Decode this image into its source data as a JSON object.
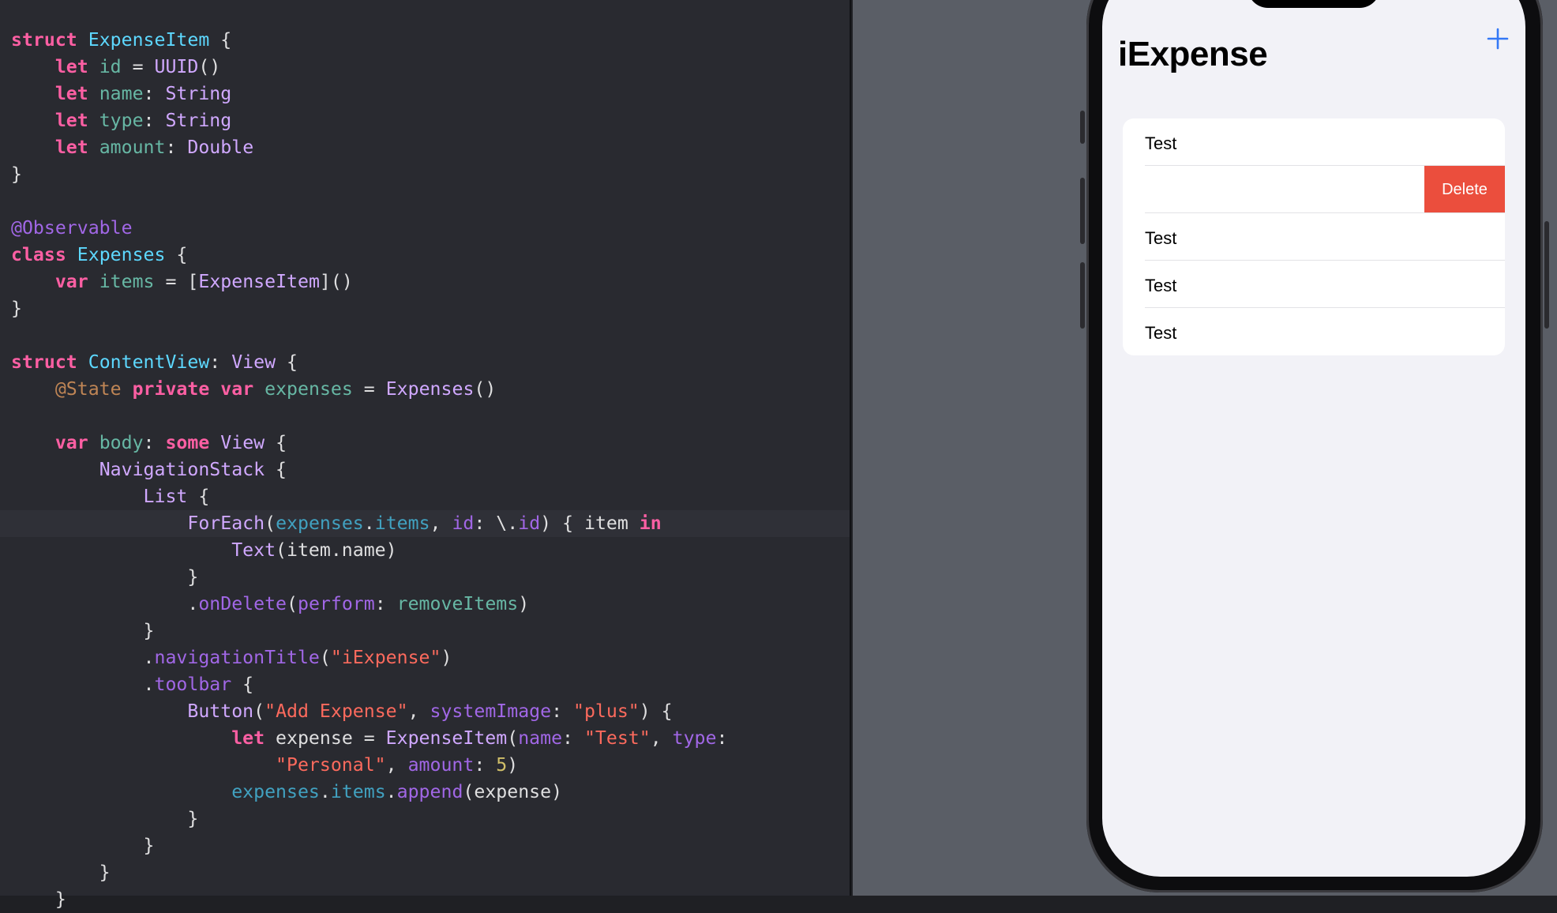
{
  "editor": {
    "lines": [
      [
        [
          "kw",
          "struct"
        ],
        [
          "plain",
          " "
        ],
        [
          "tydecl",
          "ExpenseItem"
        ],
        [
          "plain",
          " {"
        ]
      ],
      [
        [
          "plain",
          "    "
        ],
        [
          "kw",
          "let"
        ],
        [
          "plain",
          " "
        ],
        [
          "prop",
          "id"
        ],
        [
          "plain",
          " = "
        ],
        [
          "tyref",
          "UUID"
        ],
        [
          "plain",
          "()"
        ]
      ],
      [
        [
          "plain",
          "    "
        ],
        [
          "kw",
          "let"
        ],
        [
          "plain",
          " "
        ],
        [
          "prop",
          "name"
        ],
        [
          "plain",
          ": "
        ],
        [
          "tyref",
          "String"
        ]
      ],
      [
        [
          "plain",
          "    "
        ],
        [
          "kw",
          "let"
        ],
        [
          "plain",
          " "
        ],
        [
          "prop",
          "type"
        ],
        [
          "plain",
          ": "
        ],
        [
          "tyref",
          "String"
        ]
      ],
      [
        [
          "plain",
          "    "
        ],
        [
          "kw",
          "let"
        ],
        [
          "plain",
          " "
        ],
        [
          "prop",
          "amount"
        ],
        [
          "plain",
          ": "
        ],
        [
          "tyref",
          "Double"
        ]
      ],
      [
        [
          "plain",
          "}"
        ]
      ],
      [
        [
          "plain",
          ""
        ]
      ],
      [
        [
          "macro",
          "@Observable"
        ]
      ],
      [
        [
          "kw",
          "class"
        ],
        [
          "plain",
          " "
        ],
        [
          "tydecl",
          "Expenses"
        ],
        [
          "plain",
          " {"
        ]
      ],
      [
        [
          "plain",
          "    "
        ],
        [
          "kw",
          "var"
        ],
        [
          "plain",
          " "
        ],
        [
          "prop",
          "items"
        ],
        [
          "plain",
          " = ["
        ],
        [
          "tyref",
          "ExpenseItem"
        ],
        [
          "plain",
          "]()"
        ]
      ],
      [
        [
          "plain",
          "}"
        ]
      ],
      [
        [
          "plain",
          ""
        ]
      ],
      [
        [
          "kw",
          "struct"
        ],
        [
          "plain",
          " "
        ],
        [
          "tydecl",
          "ContentView"
        ],
        [
          "plain",
          ": "
        ],
        [
          "tyref",
          "View"
        ],
        [
          "plain",
          " {"
        ]
      ],
      [
        [
          "plain",
          "    "
        ],
        [
          "attr",
          "@State"
        ],
        [
          "plain",
          " "
        ],
        [
          "kw",
          "private"
        ],
        [
          "plain",
          " "
        ],
        [
          "kw",
          "var"
        ],
        [
          "plain",
          " "
        ],
        [
          "prop",
          "expenses"
        ],
        [
          "plain",
          " = "
        ],
        [
          "tyref",
          "Expenses"
        ],
        [
          "plain",
          "()"
        ]
      ],
      [
        [
          "plain",
          ""
        ]
      ],
      [
        [
          "plain",
          "    "
        ],
        [
          "kw",
          "var"
        ],
        [
          "plain",
          " "
        ],
        [
          "prop",
          "body"
        ],
        [
          "plain",
          ": "
        ],
        [
          "kw",
          "some"
        ],
        [
          "plain",
          " "
        ],
        [
          "tyref",
          "View"
        ],
        [
          "plain",
          " {"
        ]
      ],
      [
        [
          "plain",
          "        "
        ],
        [
          "tyref",
          "NavigationStack"
        ],
        [
          "plain",
          " {"
        ]
      ],
      [
        [
          "plain",
          "            "
        ],
        [
          "tyref",
          "List"
        ],
        [
          "plain",
          " {"
        ]
      ],
      [
        [
          "plain",
          "                "
        ],
        [
          "tyref",
          "ForEach"
        ],
        [
          "plain",
          "("
        ],
        [
          "propref",
          "expenses"
        ],
        [
          "plain",
          "."
        ],
        [
          "propref",
          "items"
        ],
        [
          "plain",
          ", "
        ],
        [
          "param",
          "id"
        ],
        [
          "plain",
          ": \\."
        ],
        [
          "param",
          "id"
        ],
        [
          "plain",
          ") { item "
        ],
        [
          "kw",
          "in"
        ]
      ],
      [
        [
          "plain",
          "                    "
        ],
        [
          "tyref",
          "Text"
        ],
        [
          "plain",
          "(item.name)"
        ]
      ],
      [
        [
          "plain",
          "                }"
        ]
      ],
      [
        [
          "plain",
          "                ."
        ],
        [
          "funcref",
          "onDelete"
        ],
        [
          "plain",
          "("
        ],
        [
          "param",
          "perform"
        ],
        [
          "plain",
          ": "
        ],
        [
          "func",
          "removeItems"
        ],
        [
          "plain",
          ")"
        ]
      ],
      [
        [
          "plain",
          "            }"
        ]
      ],
      [
        [
          "plain",
          "            ."
        ],
        [
          "funcref",
          "navigationTitle"
        ],
        [
          "plain",
          "("
        ],
        [
          "str",
          "\"iExpense\""
        ],
        [
          "plain",
          ")"
        ]
      ],
      [
        [
          "plain",
          "            ."
        ],
        [
          "funcref",
          "toolbar"
        ],
        [
          "plain",
          " {"
        ]
      ],
      [
        [
          "plain",
          "                "
        ],
        [
          "tyref",
          "Button"
        ],
        [
          "plain",
          "("
        ],
        [
          "str",
          "\"Add Expense\""
        ],
        [
          "plain",
          ", "
        ],
        [
          "param",
          "systemImage"
        ],
        [
          "plain",
          ": "
        ],
        [
          "str",
          "\"plus\""
        ],
        [
          "plain",
          ") {"
        ]
      ],
      [
        [
          "plain",
          "                    "
        ],
        [
          "kw",
          "let"
        ],
        [
          "plain",
          " expense = "
        ],
        [
          "tyref",
          "ExpenseItem"
        ],
        [
          "plain",
          "("
        ],
        [
          "param",
          "name"
        ],
        [
          "plain",
          ": "
        ],
        [
          "str",
          "\"Test\""
        ],
        [
          "plain",
          ", "
        ],
        [
          "param",
          "type"
        ],
        [
          "plain",
          ":"
        ]
      ],
      [
        [
          "plain",
          "                        "
        ],
        [
          "str",
          "\"Personal\""
        ],
        [
          "plain",
          ", "
        ],
        [
          "param",
          "amount"
        ],
        [
          "plain",
          ": "
        ],
        [
          "num",
          "5"
        ],
        [
          "plain",
          ")"
        ]
      ],
      [
        [
          "plain",
          "                    "
        ],
        [
          "propref",
          "expenses"
        ],
        [
          "plain",
          "."
        ],
        [
          "propref",
          "items"
        ],
        [
          "plain",
          "."
        ],
        [
          "funcref",
          "append"
        ],
        [
          "plain",
          "(expense)"
        ]
      ],
      [
        [
          "plain",
          "                }"
        ]
      ],
      [
        [
          "plain",
          "            }"
        ]
      ],
      [
        [
          "plain",
          "        }"
        ]
      ],
      [
        [
          "plain",
          "    }"
        ]
      ]
    ],
    "colors": {
      "keyword": "#fc5fa3",
      "type": "#d0a8ff",
      "type_declaration": "#5dd8ff",
      "string": "#fc6a5d",
      "number": "#d0bf69",
      "property": "#67b7a4",
      "background": "#292a30"
    }
  },
  "preview": {
    "nav_title": "iExpense",
    "toolbar_icon": "plus-icon",
    "accent_color": "#3478f6",
    "rows": [
      {
        "label": "Test",
        "swiped": false
      },
      {
        "label": "",
        "swiped": true,
        "action": "Delete"
      },
      {
        "label": "Test",
        "swiped": false
      },
      {
        "label": "Test",
        "swiped": false
      },
      {
        "label": "Test",
        "swiped": false
      }
    ],
    "delete_color": "#eb4e3d"
  }
}
